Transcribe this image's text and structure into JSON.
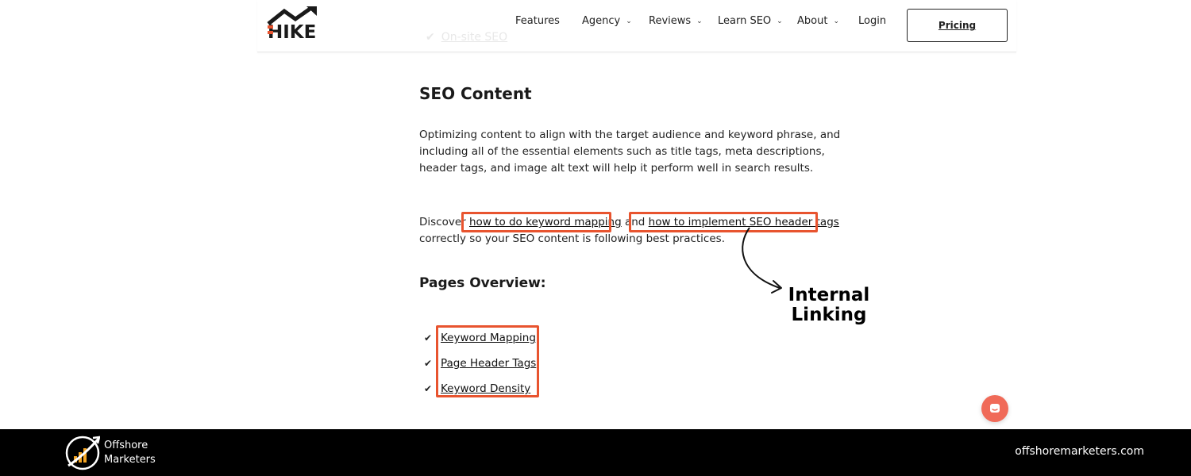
{
  "header": {
    "partial_link": "On-site SEO",
    "logo_text": "HIKE",
    "nav": [
      {
        "label": "Features",
        "has_dropdown": false
      },
      {
        "label": "Agency",
        "has_dropdown": true
      },
      {
        "label": "Reviews",
        "has_dropdown": true
      },
      {
        "label": "Learn SEO",
        "has_dropdown": true
      },
      {
        "label": "About",
        "has_dropdown": true
      },
      {
        "label": "Login",
        "has_dropdown": false
      }
    ],
    "pricing_label": "Pricing"
  },
  "article": {
    "heading": "SEO Content",
    "paragraph": "Optimizing content to align with the target audience and keyword phrase, and including all of the essential elements such as title tags, meta descriptions, header tags, and image alt text will help it perform well in search results.",
    "discover_prefix": "Discover ",
    "link1": "how to do keyword mapping",
    "and_text": " and ",
    "link2": "how to implement SEO header tags",
    "discover_suffix": "correctly so your SEO content is following best practices.",
    "subheading": "Pages Overview:",
    "pages": [
      "Keyword Mapping",
      "Page Header Tags",
      "Keyword Density"
    ]
  },
  "annotation": {
    "line1": "Internal",
    "line2": "Linking"
  },
  "footer": {
    "brand_line1": "Offshore",
    "brand_line2": "Marketers",
    "url": "offshoremarketers.com"
  },
  "colors": {
    "highlight": "#e8542f",
    "chat_bubble": "#f06a58",
    "footer_bg": "#000000"
  }
}
